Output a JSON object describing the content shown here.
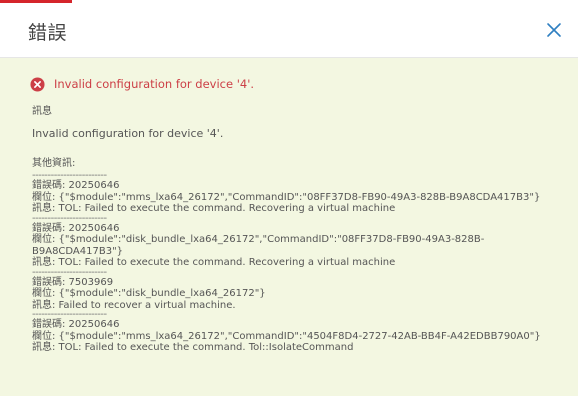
{
  "dialog": {
    "title": "錯誤",
    "close_icon": "close-icon",
    "error_icon": "error-circle-icon",
    "error_message": "Invalid configuration for device '4'.",
    "message_label": "訊息",
    "message_text": "Invalid configuration for device '4'.",
    "more_info_label": "其他資訊:",
    "separator": "------------------------",
    "entries": [
      {
        "code": "錯誤碼: 20250646",
        "field": "欄位: {\"$module\":\"mms_lxa64_26172\",\"CommandID\":\"08FF37D8-FB90-49A3-828B-B9A8CDA417B3\"}",
        "msg": "訊息: TOL: Failed to execute the command. Recovering a virtual machine"
      },
      {
        "code": "錯誤碼: 20250646",
        "field": "欄位: {\"$module\":\"disk_bundle_lxa64_26172\",\"CommandID\":\"08FF37D8-FB90-49A3-828B-B9A8CDA417B3\"}",
        "msg": "訊息: TOL: Failed to execute the command. Recovering a virtual machine"
      },
      {
        "code": "錯誤碼: 7503969",
        "field": "欄位: {\"$module\":\"disk_bundle_lxa64_26172\"}",
        "msg": "訊息: Failed to recover a virtual machine."
      },
      {
        "code": "錯誤碼: 20250646",
        "field": "欄位: {\"$module\":\"mms_lxa64_26172\",\"CommandID\":\"4504F8D4-2727-42AB-BB4F-A42EDBB790A0\"}",
        "msg": "訊息: TOL: Failed to execute the command. Tol::IsolateCommand"
      }
    ]
  },
  "colors": {
    "accent": "#d5252b",
    "error": "#cc3f46",
    "body_bg": "#f3f7e1",
    "close": "#2f7fc1"
  }
}
